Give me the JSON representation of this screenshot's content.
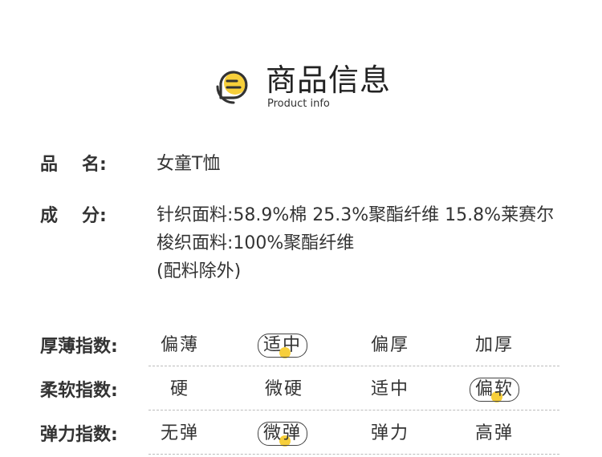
{
  "header": {
    "title": "商品信息",
    "subtitle": "Product info",
    "accent_color": "#f7cf3a"
  },
  "product": {
    "name_label_a": "品",
    "name_label_b": "名:",
    "name_value": "女童T恤",
    "comp_label_a": "成",
    "comp_label_b": "分:",
    "comp_lines": [
      "针织面料:58.9%棉 25.3%聚酯纤维 15.8%莱赛尔",
      "梭织面料:100%聚酯纤维",
      "(配料除外)"
    ]
  },
  "indices": [
    {
      "label": "厚薄指数:",
      "options": [
        "偏薄",
        "适中",
        "偏厚",
        "加厚"
      ],
      "selected": 1
    },
    {
      "label": "柔软指数:",
      "options": [
        "硬",
        "微硬",
        "适中",
        "偏软"
      ],
      "selected": 3
    },
    {
      "label": "弹力指数:",
      "options": [
        "无弹",
        "微弹",
        "弹力",
        "高弹"
      ],
      "selected": 1
    }
  ]
}
